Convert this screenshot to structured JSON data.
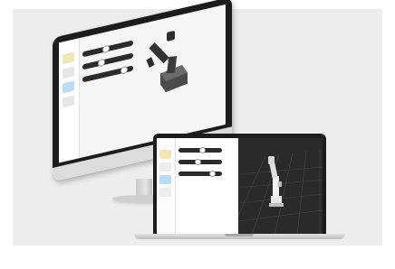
{
  "scene": {
    "colors": {
      "backdrop": "#ecedec",
      "device_frame": "#1c1c1c",
      "slider_track": "#2b2b2b",
      "viewport": "#2a2a2a",
      "highlight_yellow": "#f0e8b8",
      "highlight_blue": "#b9dbf3"
    }
  },
  "monitor": {
    "app": {
      "sliders": [
        {
          "level": 0.45
        },
        {
          "level": 0.35
        },
        {
          "level": 0.88
        }
      ],
      "sidebar_icons": [
        "robot-arm-icon",
        "joint-icon",
        "target-icon",
        "settings-icon"
      ]
    }
  },
  "laptop": {
    "app": {
      "sliders": [
        {
          "level": 0.55
        },
        {
          "level": 0.45
        },
        {
          "level": 0.82
        }
      ],
      "sidebar_icons": [
        "robot-arm-icon",
        "joint-icon",
        "target-icon",
        "settings-icon"
      ]
    }
  }
}
